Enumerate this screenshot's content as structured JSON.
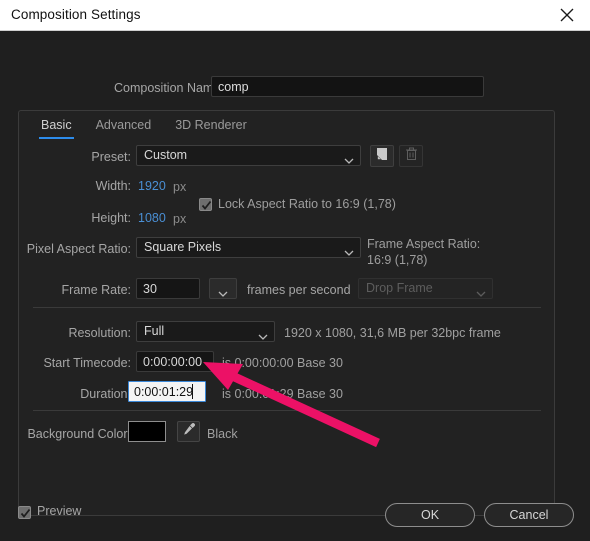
{
  "window": {
    "title": "Composition Settings",
    "close_icon": "close-icon"
  },
  "composition_name": {
    "label": "Composition Name:",
    "value": "comp"
  },
  "tabs": [
    {
      "label": "Basic",
      "active": true
    },
    {
      "label": "Advanced",
      "active": false
    },
    {
      "label": "3D Renderer",
      "active": false
    }
  ],
  "preset": {
    "label": "Preset:",
    "value": "Custom",
    "save_icon": "save-preset-icon",
    "delete_icon": "trash-icon"
  },
  "dimensions": {
    "width_label": "Width:",
    "width_value": "1920",
    "width_unit": "px",
    "height_label": "Height:",
    "height_value": "1080",
    "height_unit": "px",
    "lock_aspect_label": "Lock Aspect Ratio to 16:9 (1,78)",
    "lock_aspect_checked": true
  },
  "pixel_aspect": {
    "label": "Pixel Aspect Ratio:",
    "value": "Square Pixels",
    "frame_aspect_label": "Frame Aspect Ratio:",
    "frame_aspect_value": "16:9 (1,78)"
  },
  "frame_rate": {
    "label": "Frame Rate:",
    "value": "30",
    "unit": "frames per second",
    "drop_frame": "Drop Frame"
  },
  "resolution": {
    "label": "Resolution:",
    "value": "Full",
    "info": "1920 x 1080, 31,6 MB per 32bpc frame"
  },
  "start_timecode": {
    "label": "Start Timecode:",
    "value": "0:00:00:00",
    "info": "is 0:00:00:00  Base 30"
  },
  "duration": {
    "label": "Duration:",
    "value": "0:00:01:29",
    "info": "is 0:00:01:29  Base 30"
  },
  "background_color": {
    "label": "Background Color:",
    "swatch_hex": "#000000",
    "eyedropper_icon": "eyedropper-icon",
    "name": "Black"
  },
  "footer": {
    "preview_label": "Preview",
    "preview_checked": true,
    "ok_label": "OK",
    "cancel_label": "Cancel"
  },
  "annotation": {
    "arrow_color": "#ec1166",
    "arrow_name": "pointer-arrow-annotation"
  },
  "colors": {
    "accent_blue": "#2d8ceb",
    "value_blue": "#4a8fd4",
    "dialog_bg": "#1f1f1f",
    "panel_bg": "#222222"
  }
}
